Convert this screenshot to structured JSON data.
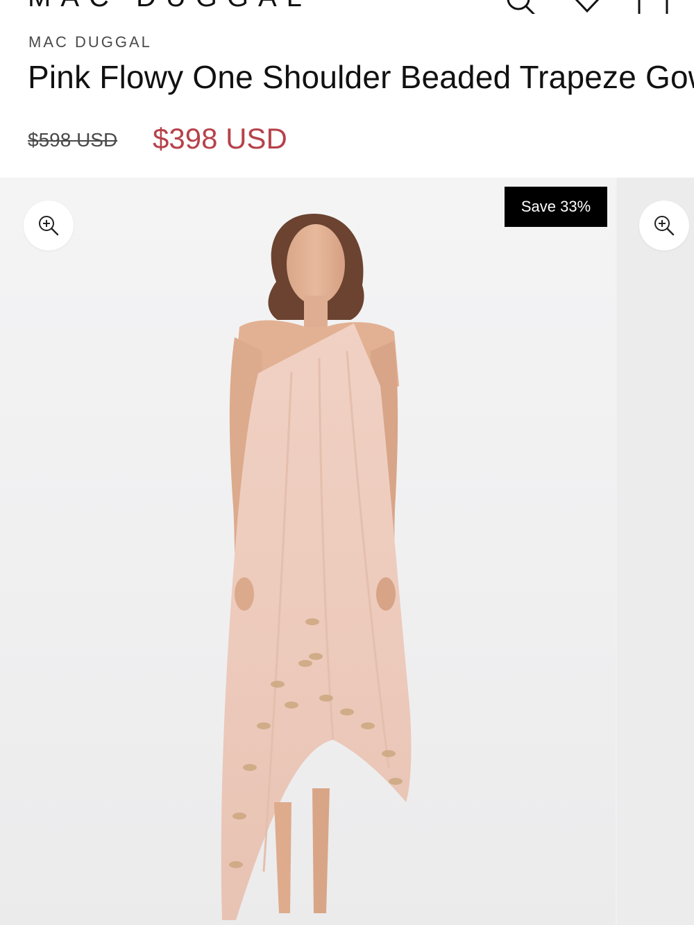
{
  "header": {
    "logo_text": "MAC DUGGAL",
    "icons": [
      "search-icon",
      "heart-icon",
      "bag-icon"
    ]
  },
  "product": {
    "brand": "MAC DUGGAL",
    "title": "Pink Flowy One Shoulder Beaded Trapeze Gown",
    "price_original": "$598 USD",
    "price_sale": "$398 USD",
    "sale_color": "#b6424b"
  },
  "gallery": {
    "badge": "Save 33%",
    "zoom_icon": "zoom-in-icon",
    "image_description_icon": "product-photo"
  }
}
